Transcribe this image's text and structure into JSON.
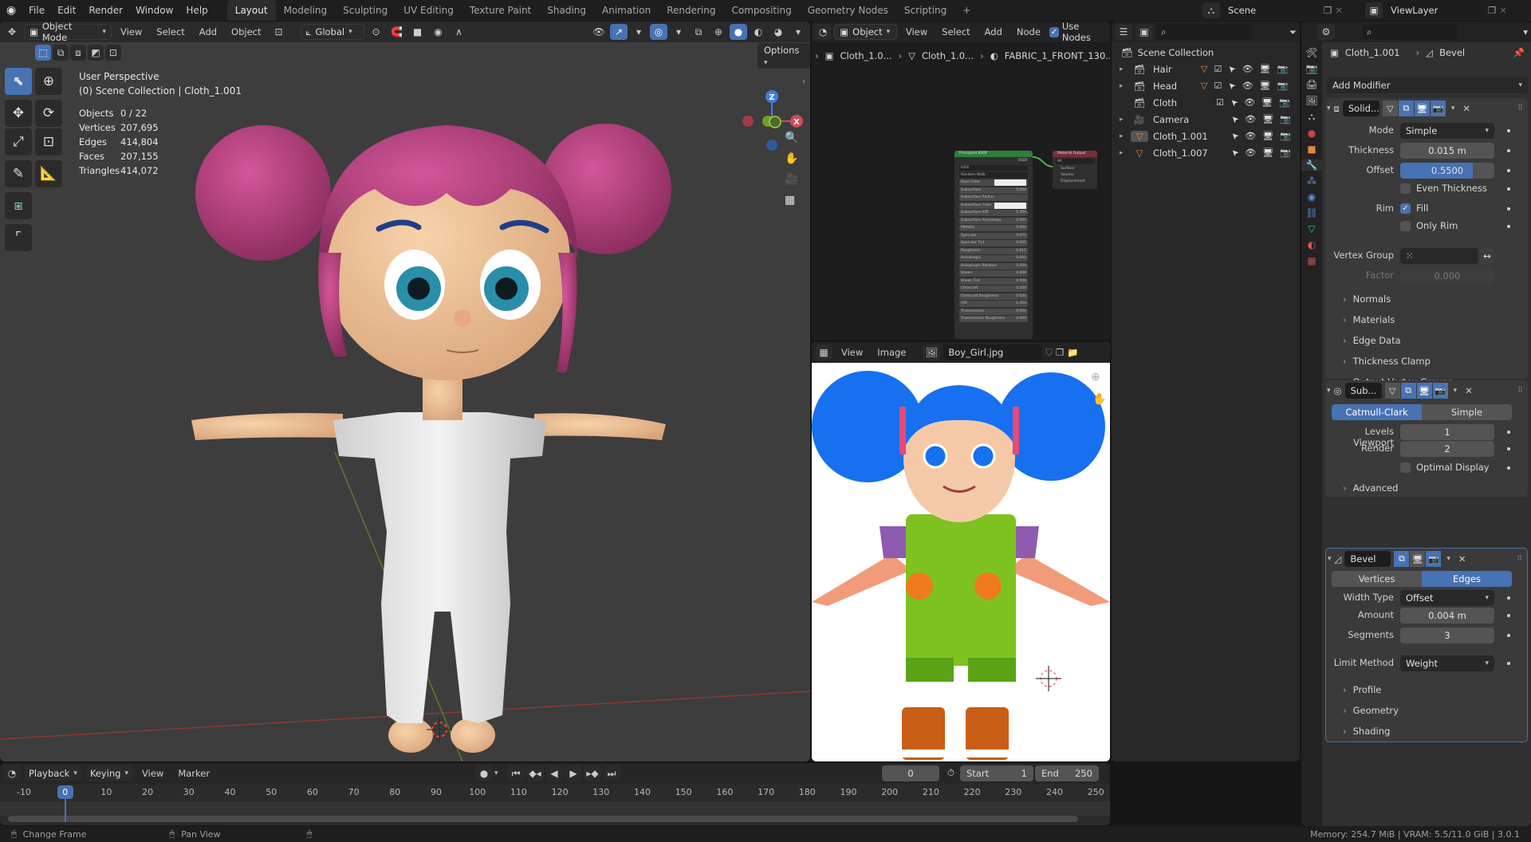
{
  "app": {
    "menus": [
      "File",
      "Edit",
      "Render",
      "Window",
      "Help"
    ],
    "workspaces": [
      {
        "label": "Layout",
        "active": true
      },
      {
        "label": "Modeling"
      },
      {
        "label": "Sculpting"
      },
      {
        "label": "UV Editing"
      },
      {
        "label": "Texture Paint"
      },
      {
        "label": "Shading"
      },
      {
        "label": "Animation"
      },
      {
        "label": "Rendering"
      },
      {
        "label": "Compositing"
      },
      {
        "label": "Geometry Nodes"
      },
      {
        "label": "Scripting"
      }
    ],
    "add_workspace": "+",
    "scene": "Scene",
    "view_layer": "ViewLayer"
  },
  "viewport": {
    "mode": "Object Mode",
    "menus": [
      "View",
      "Select",
      "Add",
      "Object"
    ],
    "transform_orientation": "Global",
    "options_label": "Options",
    "overlay_title": "User Perspective",
    "overlay_subtitle": "(0) Scene Collection | Cloth_1.001",
    "stats": [
      {
        "label": "Objects",
        "value": "0 / 22"
      },
      {
        "label": "Vertices",
        "value": "207,695"
      },
      {
        "label": "Edges",
        "value": "414,804"
      },
      {
        "label": "Faces",
        "value": "207,155"
      },
      {
        "label": "Triangles",
        "value": "414,072"
      }
    ],
    "gizmo": {
      "z": "Z",
      "x": "X",
      "y": "Y"
    },
    "colors": {
      "x_axis": "#d24a5a",
      "y_axis": "#8ab933",
      "z_axis": "#3b7fe0",
      "hair": "#b8407a",
      "skin": "#f1c49a",
      "cloth": "#e6e6e6"
    }
  },
  "shader_editor": {
    "object_type": "Object",
    "menus": [
      "View",
      "Select",
      "Add",
      "Node"
    ],
    "use_nodes_label": "Use Nodes",
    "use_nodes": true,
    "breadcrumb": [
      "Cloth_1.0...",
      "Cloth_1.0...",
      "FABRIC_1_FRONT_130..."
    ],
    "node_bsdf": {
      "title": "Principled BSDF",
      "output": "BSDF",
      "dist": "GGX",
      "ss_method": "Random Walk",
      "rows": [
        {
          "label": "Base Color",
          "value": ""
        },
        {
          "label": "Subsurface",
          "value": "0.000"
        },
        {
          "label": "Subsurface Radius",
          "value": ""
        },
        {
          "label": "Subsurface Color",
          "value": ""
        },
        {
          "label": "Subsurface IOR",
          "value": "1.400"
        },
        {
          "label": "Subsurface Anisotropy",
          "value": "0.000"
        },
        {
          "label": "Metallic",
          "value": "0.000"
        },
        {
          "label": "Specular",
          "value": "0.075"
        },
        {
          "label": "Specular Tint",
          "value": "0.000"
        },
        {
          "label": "Roughness",
          "value": "0.811"
        },
        {
          "label": "Anisotropic",
          "value": "0.000"
        },
        {
          "label": "Anisotropic Rotation",
          "value": "0.000"
        },
        {
          "label": "Sheen",
          "value": "0.000"
        },
        {
          "label": "Sheen Tint",
          "value": "0.500"
        },
        {
          "label": "Clearcoat",
          "value": "0.000"
        },
        {
          "label": "Clearcoat Roughness",
          "value": "0.030"
        },
        {
          "label": "IOR",
          "value": "1.450"
        },
        {
          "label": "Transmission",
          "value": "0.000"
        },
        {
          "label": "Transmission Roughness",
          "value": "0.000"
        }
      ]
    },
    "node_output": {
      "title": "Material Output",
      "target": "All",
      "sockets": [
        "Surface",
        "Volume",
        "Displacement"
      ]
    }
  },
  "image_editor": {
    "menus": [
      "View",
      "Image"
    ],
    "image_name": "Boy_Girl.jpg"
  },
  "outliner": {
    "search_placeholder": "",
    "root": "Scene Collection",
    "items": [
      {
        "name": "Hair",
        "type": "collection",
        "expandable": true,
        "checked": true
      },
      {
        "name": "Head",
        "type": "collection",
        "expandable": true,
        "checked": true
      },
      {
        "name": "Cloth",
        "type": "collection",
        "expandable": false,
        "checked": true
      },
      {
        "name": "Camera",
        "type": "camera",
        "expandable": true
      },
      {
        "name": "Cloth_1.001",
        "type": "mesh",
        "expandable": true,
        "active": true
      },
      {
        "name": "Cloth_1.007",
        "type": "mesh",
        "expandable": true
      }
    ]
  },
  "properties": {
    "breadcrumb_object": "Cloth_1.001",
    "breadcrumb_modifier": "Bevel",
    "add_modifier": "Add Modifier",
    "solidify": {
      "name": "Solid...",
      "mode_label": "Mode",
      "mode": "Simple",
      "thickness_label": "Thickness",
      "thickness": "0.015 m",
      "offset_label": "Offset",
      "offset": "0.5500",
      "offset_fraction": 0.775,
      "even_thickness_label": "Even Thickness",
      "even_thickness": false,
      "rim_label": "Rim",
      "fill_label": "Fill",
      "fill": true,
      "only_rim_label": "Only Rim",
      "only_rim": false,
      "vertex_group_label": "Vertex Group",
      "vertex_group": "",
      "factor_label": "Factor",
      "factor": "0.000",
      "subpanels": [
        "Normals",
        "Materials",
        "Edge Data",
        "Thickness Clamp",
        "Output Vertex Groups"
      ]
    },
    "subdivision": {
      "name": "Sub...",
      "types": [
        "Catmull-Clark",
        "Simple"
      ],
      "active_type": "Catmull-Clark",
      "levels_viewport_label": "Levels Viewport",
      "levels_viewport": "1",
      "render_label": "Render",
      "render": "2",
      "optimal_display_label": "Optimal Display",
      "optimal_display": false,
      "subpanels": [
        "Advanced"
      ]
    },
    "bevel": {
      "name": "Bevel",
      "affect": [
        "Vertices",
        "Edges"
      ],
      "active_affect": "Edges",
      "width_type_label": "Width Type",
      "width_type": "Offset",
      "amount_label": "Amount",
      "amount": "0.004 m",
      "segments_label": "Segments",
      "segments": "3",
      "limit_method_label": "Limit Method",
      "limit_method": "Weight",
      "subpanels": [
        "Profile",
        "Geometry",
        "Shading"
      ]
    }
  },
  "timeline": {
    "menus": [
      "Playback",
      "Keying",
      "View",
      "Marker"
    ],
    "current_frame": "0",
    "start_label": "Start",
    "start": "1",
    "end_label": "End",
    "end": "250",
    "ticks": [
      "-10",
      "0",
      "10",
      "20",
      "30",
      "40",
      "50",
      "60",
      "70",
      "80",
      "90",
      "100",
      "110",
      "120",
      "130",
      "140",
      "150",
      "160",
      "170",
      "180",
      "190",
      "200",
      "210",
      "220",
      "230",
      "240",
      "250"
    ]
  },
  "statusbar": {
    "hint_left": "Change Frame",
    "hint_mid": "Pan View",
    "info": "Memory: 254.7 MiB | VRAM: 5.5/11.0 GiB | 3.0.1"
  }
}
